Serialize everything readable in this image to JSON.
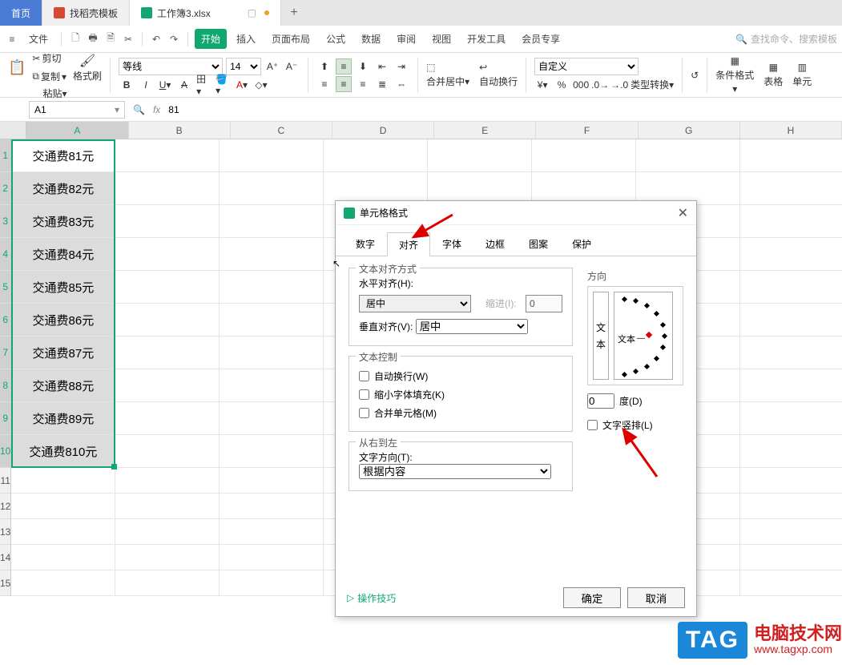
{
  "tabs": {
    "home": "首页",
    "template": "找稻壳模板",
    "file": "工作簿3.xlsx"
  },
  "menu": {
    "file": "文件",
    "items": [
      "开始",
      "插入",
      "页面布局",
      "公式",
      "数据",
      "审阅",
      "视图",
      "开发工具",
      "会员专享"
    ],
    "search_placeholder": "查找命令、搜索模板"
  },
  "ribbon": {
    "paste": "粘贴",
    "cut": "剪切",
    "copy": "复制",
    "format_painter": "格式刷",
    "font_name": "等线",
    "font_size": "14",
    "merge": "合并居中",
    "wrap": "自动换行",
    "number_format": "自定义",
    "type_convert": "类型转换",
    "cond_format": "条件格式",
    "table_style": "表格",
    "cell_style": "单元"
  },
  "fbar": {
    "name": "A1",
    "formula": "81"
  },
  "columns": [
    "A",
    "B",
    "C",
    "D",
    "E",
    "F",
    "G",
    "H"
  ],
  "rows": [
    "1",
    "2",
    "3",
    "4",
    "5",
    "6",
    "7",
    "8",
    "9",
    "10",
    "11",
    "12",
    "13",
    "14",
    "15"
  ],
  "cells_A": [
    "交通费81元",
    "交通费82元",
    "交通费83元",
    "交通费84元",
    "交通费85元",
    "交通费86元",
    "交通费87元",
    "交通费88元",
    "交通费89元",
    "交通费810元"
  ],
  "dialog": {
    "title": "单元格格式",
    "tabs": [
      "数字",
      "对齐",
      "字体",
      "边框",
      "图案",
      "保护"
    ],
    "active_tab": "对齐",
    "group_align": "文本对齐方式",
    "h_align_label": "水平对齐(H):",
    "h_align_value": "居中",
    "indent_label": "缩进(I):",
    "indent_value": "0",
    "v_align_label": "垂直对齐(V):",
    "v_align_value": "居中",
    "group_ctrl": "文本控制",
    "wrap": "自动换行(W)",
    "shrink": "缩小字体填充(K)",
    "merge": "合并单元格(M)",
    "group_rtl": "从右到左",
    "textdir_label": "文字方向(T):",
    "textdir_value": "根据内容",
    "orient": "方向",
    "orient_v1": "文",
    "orient_v2": "本",
    "orient_lbl": "文本",
    "deg_value": "0",
    "deg_label": "度(D)",
    "vertical_text": "文字竖排(L)",
    "tips": "操作技巧",
    "ok": "确定",
    "cancel": "取消"
  },
  "watermark": {
    "tag": "TAG",
    "line1": "电脑技术网",
    "line2": "www.tagxp.com"
  }
}
